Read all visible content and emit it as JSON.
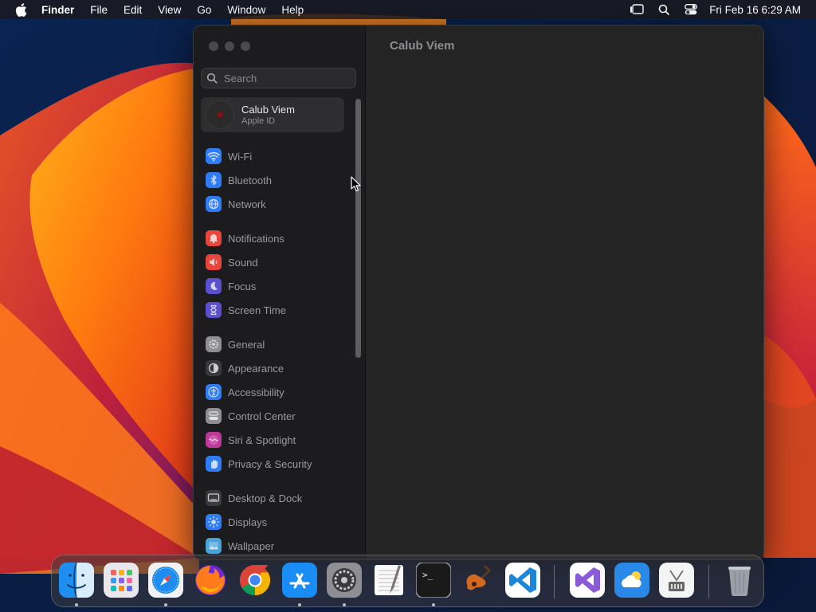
{
  "menubar": {
    "app_name": "Finder",
    "menus": [
      "File",
      "Edit",
      "View",
      "Go",
      "Window",
      "Help"
    ],
    "clock": "Fri Feb 16  6:29 AM"
  },
  "settings": {
    "search_placeholder": "Search",
    "account": {
      "name": "Calub Viem",
      "subtitle": "Apple ID"
    },
    "main_title": "Calub Viem",
    "sidebar_items": [
      {
        "label": "Wi-Fi",
        "icon": "wifi-icon",
        "color": "#2f7cf6"
      },
      {
        "label": "Bluetooth",
        "icon": "bluetooth-icon",
        "color": "#2f7cf6"
      },
      {
        "label": "Network",
        "icon": "globe-icon",
        "color": "#2f7cf6"
      },
      {
        "label": "Notifications",
        "icon": "bell-icon",
        "color": "#e8453c"
      },
      {
        "label": "Sound",
        "icon": "speaker-icon",
        "color": "#e8453c"
      },
      {
        "label": "Focus",
        "icon": "moon-icon",
        "color": "#5a4fcf"
      },
      {
        "label": "Screen Time",
        "icon": "hourglass-icon",
        "color": "#5a4fcf"
      },
      {
        "label": "General",
        "icon": "gear-icon",
        "color": "#8e8e93"
      },
      {
        "label": "Appearance",
        "icon": "appearance-icon",
        "color": "#3a3a3c"
      },
      {
        "label": "Accessibility",
        "icon": "accessibility-icon",
        "color": "#2f7cf6"
      },
      {
        "label": "Control Center",
        "icon": "control-center-icon",
        "color": "#8e8e93"
      },
      {
        "label": "Siri & Spotlight",
        "icon": "siri-icon",
        "color": "#c0389a"
      },
      {
        "label": "Privacy & Security",
        "icon": "hand-icon",
        "color": "#2f7cf6"
      },
      {
        "label": "Desktop & Dock",
        "icon": "desktop-icon",
        "color": "#3a3a3c"
      },
      {
        "label": "Displays",
        "icon": "sun-icon",
        "color": "#2f7cf6"
      },
      {
        "label": "Wallpaper",
        "icon": "wallpaper-icon",
        "color": "#4aa3d8"
      }
    ]
  },
  "dock": {
    "apps": [
      {
        "name": "Finder",
        "icon": "finder-icon",
        "running": true
      },
      {
        "name": "Launchpad",
        "icon": "launchpad-icon",
        "running": false
      },
      {
        "name": "Safari",
        "icon": "safari-icon",
        "running": true
      },
      {
        "name": "Firefox",
        "icon": "firefox-icon",
        "running": false
      },
      {
        "name": "Chrome",
        "icon": "chrome-icon",
        "running": false
      },
      {
        "name": "App Store",
        "icon": "app-store-icon",
        "running": true
      },
      {
        "name": "System Settings",
        "icon": "system-settings-icon",
        "running": true
      },
      {
        "name": "TextEdit",
        "icon": "textedit-icon",
        "running": false
      },
      {
        "name": "Terminal",
        "icon": "terminal-icon",
        "running": true
      },
      {
        "name": "GarageBand",
        "icon": "guitar-icon",
        "running": false
      },
      {
        "name": "Visual Studio Code",
        "icon": "vscode-icon",
        "running": false
      },
      {
        "name": "Visual Studio",
        "icon": "visual-studio-icon",
        "running": false
      },
      {
        "name": "Weather",
        "icon": "weather-icon",
        "running": false
      },
      {
        "name": "Archive Utility",
        "icon": "archive-utility-icon",
        "running": false
      },
      {
        "name": "Trash",
        "icon": "trash-icon",
        "running": false
      }
    ]
  }
}
